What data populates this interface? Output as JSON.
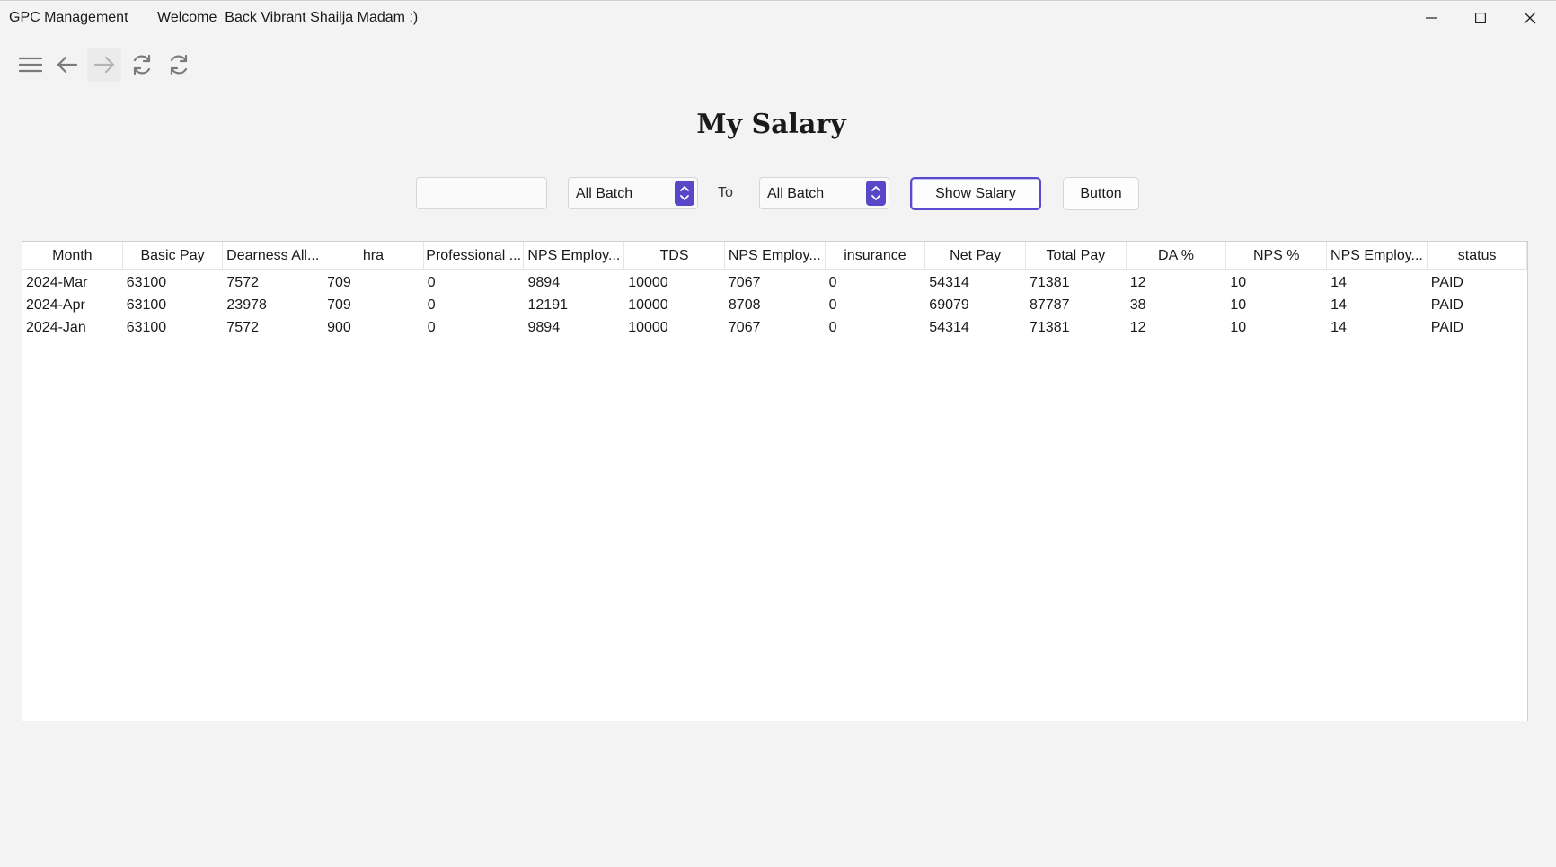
{
  "window": {
    "app_title": "GPC Management",
    "welcome_text": "Welcome  Back Vibrant Shailja Madam ;)"
  },
  "toolbar": {
    "icons": [
      "menu-icon",
      "arrow-left-icon",
      "arrow-right-icon",
      "refresh-icon",
      "refresh-icon"
    ]
  },
  "page": {
    "title": "My Salary"
  },
  "filters": {
    "search_value": "",
    "from_batch": "All Batch",
    "to_label": "To",
    "to_batch": "All Batch",
    "show_button": "Show Salary",
    "generic_button": "Button"
  },
  "colors": {
    "accent": "#5848c8"
  },
  "table": {
    "columns": [
      "Month",
      "Basic Pay",
      "Dearness All...",
      "hra",
      "Professional ...",
      "NPS Employ...",
      "TDS",
      "NPS Employ...",
      "insurance",
      "Net Pay",
      "Total Pay",
      "DA %",
      "NPS %",
      "NPS Employ...",
      "status"
    ],
    "rows": [
      [
        "2024-Mar",
        "63100",
        "7572",
        "709",
        "0",
        "9894",
        "10000",
        "7067",
        "0",
        "54314",
        "71381",
        "12",
        "10",
        "14",
        "PAID"
      ],
      [
        "2024-Apr",
        "63100",
        "23978",
        "709",
        "0",
        "12191",
        "10000",
        "8708",
        "0",
        "69079",
        "87787",
        "38",
        "10",
        "14",
        "PAID"
      ],
      [
        "2024-Jan",
        "63100",
        "7572",
        "900",
        "0",
        "9894",
        "10000",
        "7067",
        "0",
        "54314",
        "71381",
        "12",
        "10",
        "14",
        "PAID"
      ]
    ]
  }
}
